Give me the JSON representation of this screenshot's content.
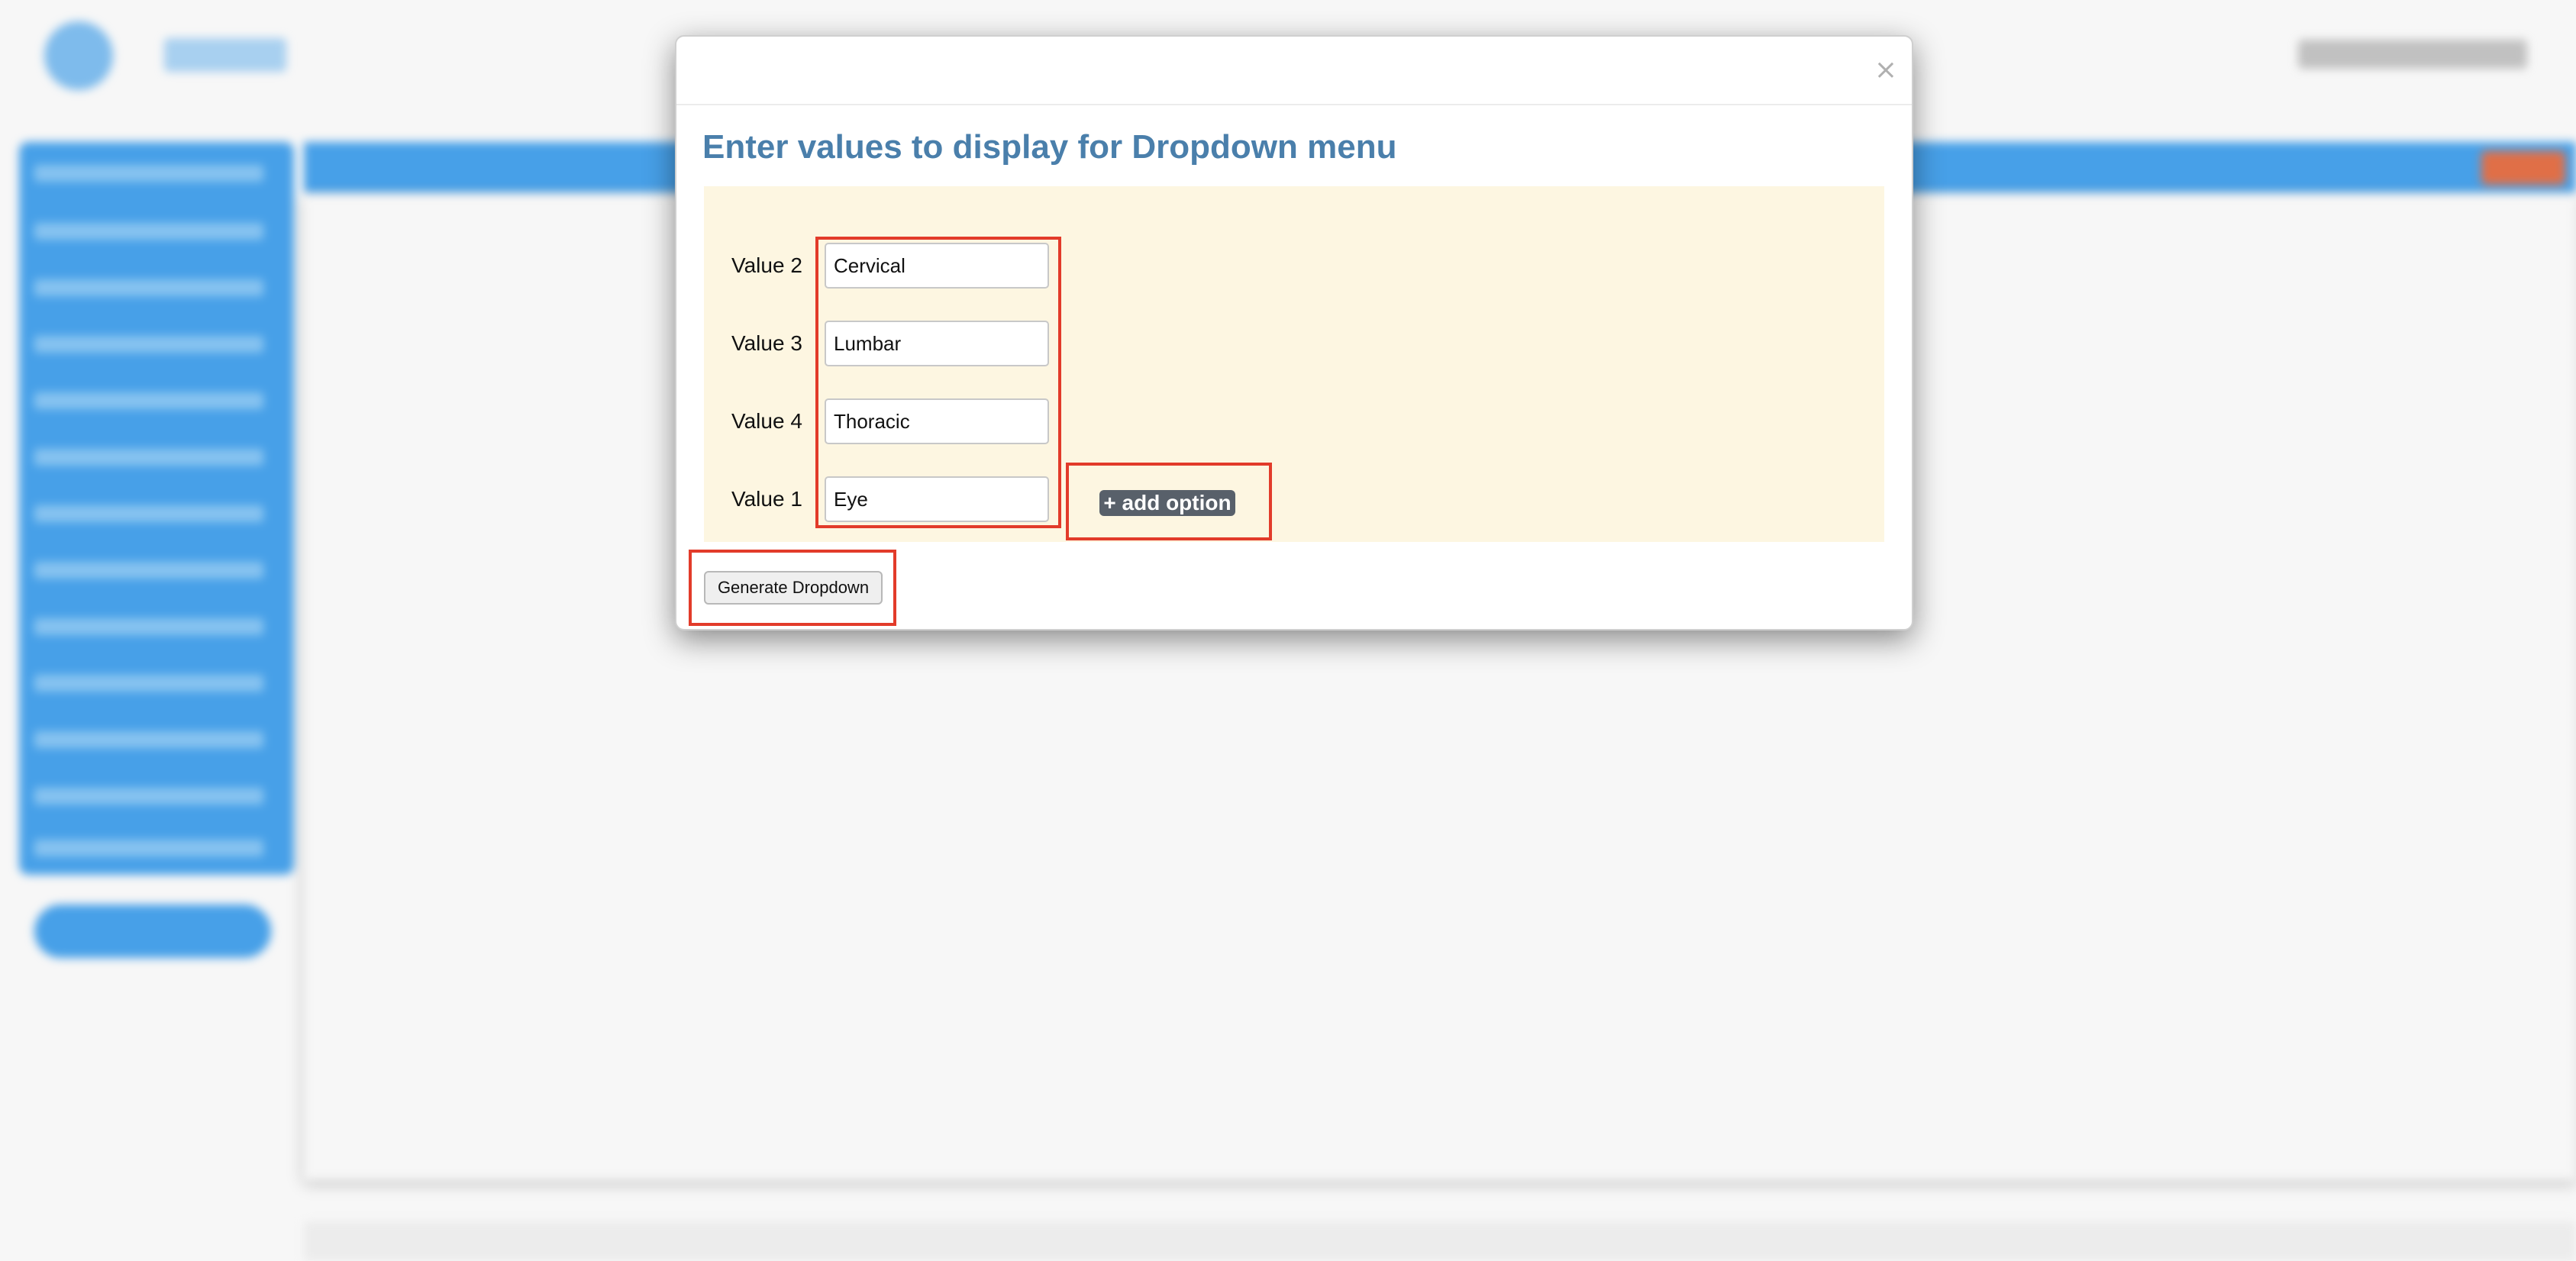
{
  "dialog": {
    "title": "Enter values to display for Dropdown menu",
    "close_symbol": "×",
    "rows": [
      {
        "label": "Value 2",
        "value": "Cervical"
      },
      {
        "label": "Value 3",
        "value": "Lumbar"
      },
      {
        "label": "Value 4",
        "value": "Thoracic"
      },
      {
        "label": "Value 1",
        "value": "Eye"
      }
    ],
    "add_option_label": "+ add option",
    "generate_label": "Generate Dropdown"
  },
  "colors": {
    "title": "#4a7fab",
    "values_background": "#fdf6e1",
    "highlight": "#e23b2a",
    "add_option_background": "#58606a",
    "background_app_blue": "#4aa6f0"
  },
  "icons": {
    "close": "close-icon"
  }
}
